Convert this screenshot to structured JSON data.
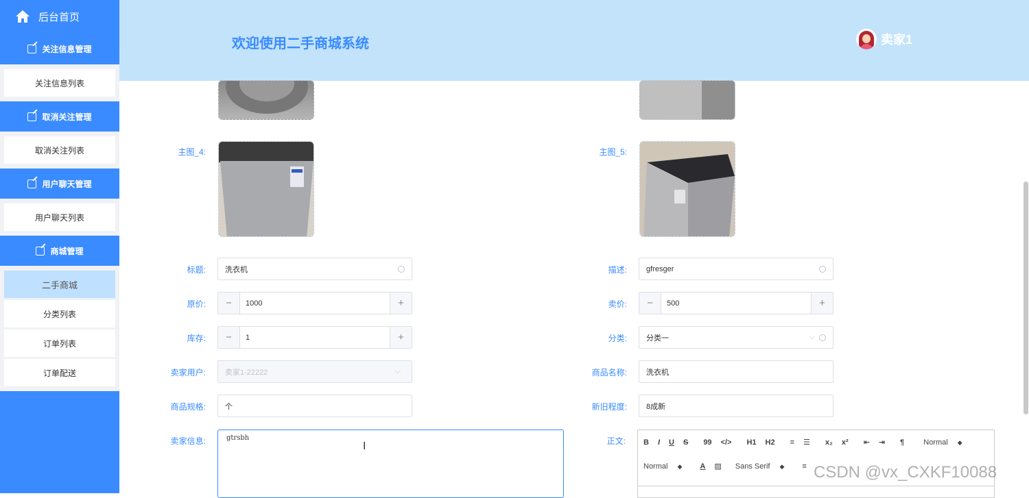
{
  "sidebar": {
    "home_label": "后台首页",
    "groups": [
      {
        "label": "关注信息管理",
        "items": [
          {
            "label": "关注信息列表"
          }
        ]
      },
      {
        "label": "取消关注管理",
        "items": [
          {
            "label": "取消关注列表"
          }
        ]
      },
      {
        "label": "用户聊天管理",
        "items": [
          {
            "label": "用户聊天列表"
          }
        ]
      },
      {
        "label": "商城管理",
        "items": [
          {
            "label": "二手商城",
            "active": true
          },
          {
            "label": "分类列表"
          },
          {
            "label": "订单列表"
          },
          {
            "label": "订单配送"
          }
        ]
      }
    ]
  },
  "header": {
    "title": "欢迎使用二手商城系统",
    "username": "卖家1"
  },
  "form": {
    "main_img_4_label": "主图_4:",
    "main_img_5_label": "主图_5:",
    "title_label": "标题:",
    "title_value": "洗衣机",
    "desc_label": "描述:",
    "desc_value": "gfresger",
    "orig_price_label": "原价:",
    "orig_price_value": "1000",
    "sale_price_label": "卖价:",
    "sale_price_value": "500",
    "stock_label": "库存:",
    "stock_value": "1",
    "category_label": "分类:",
    "category_value": "分类一",
    "seller_user_label": "卖家用户:",
    "seller_user_value": "卖家1-22222",
    "product_name_label": "商品名称:",
    "product_name_value": "洗衣机",
    "spec_label": "商品规格:",
    "spec_value": "个",
    "condition_label": "新旧程度:",
    "condition_value": "8成新",
    "seller_info_label": "卖家信息:",
    "seller_info_value": "gtrsbh",
    "body_label": "正文:"
  },
  "editor": {
    "row1": [
      "B",
      "I",
      "U",
      "S",
      "99",
      "</>",
      "H1",
      "H2",
      "≡",
      "☰",
      "x₂",
      "x²",
      "⇤",
      "⇥",
      "¶"
    ],
    "header_select": "Normal",
    "size_select": "Normal",
    "font_select": "Sans Serif"
  },
  "watermark": "CSDN @vx_CXKF10088",
  "colors": {
    "accent": "#3a8bff",
    "header_bg": "#c3e3fb",
    "active_item": "#bfe0ff"
  }
}
